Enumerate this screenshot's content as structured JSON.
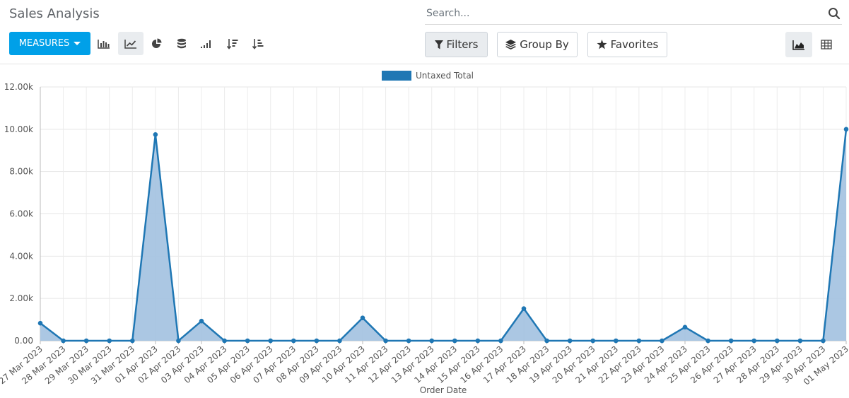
{
  "header": {
    "title": "Sales Analysis"
  },
  "search": {
    "placeholder": "Search...",
    "icon": "search-icon"
  },
  "toolbar": {
    "measures_label": "MEASURES",
    "chart_types": [
      "bar-chart-icon",
      "line-chart-icon",
      "pie-chart-icon",
      "stack-icon",
      "ascending-icon",
      "sort-descending-icon",
      "sort-ascending-icon"
    ],
    "active_chart_type": "line-chart-icon"
  },
  "filters": {
    "filters_label": "Filters",
    "group_by_label": "Group By",
    "favorites_label": "Favorites"
  },
  "views": {
    "active": "graph-view",
    "items": [
      "graph-view",
      "pivot-view"
    ]
  },
  "colors": {
    "accent": "#00a0e8",
    "series": "#1f77b4",
    "fill": "#a7c4e2"
  },
  "chart_data": {
    "type": "area",
    "xlabel": "Order Date",
    "ylabel": "",
    "ylim": [
      0,
      12000
    ],
    "yticks": [
      "0.00",
      "2.00k",
      "4.00k",
      "6.00k",
      "8.00k",
      "10.00k",
      "12.00k"
    ],
    "legend": "top-center",
    "grid": true,
    "categories": [
      "27 Mar 2023",
      "28 Mar 2023",
      "29 Mar 2023",
      "30 Mar 2023",
      "31 Mar 2023",
      "01 Apr 2023",
      "02 Apr 2023",
      "03 Apr 2023",
      "04 Apr 2023",
      "05 Apr 2023",
      "06 Apr 2023",
      "07 Apr 2023",
      "08 Apr 2023",
      "09 Apr 2023",
      "10 Apr 2023",
      "11 Apr 2023",
      "12 Apr 2023",
      "13 Apr 2023",
      "14 Apr 2023",
      "15 Apr 2023",
      "16 Apr 2023",
      "17 Apr 2023",
      "18 Apr 2023",
      "19 Apr 2023",
      "20 Apr 2023",
      "21 Apr 2023",
      "22 Apr 2023",
      "23 Apr 2023",
      "24 Apr 2023",
      "25 Apr 2023",
      "26 Apr 2023",
      "27 Apr 2023",
      "28 Apr 2023",
      "29 Apr 2023",
      "30 Apr 2023",
      "01 May 2023"
    ],
    "series": [
      {
        "name": "Untaxed Total",
        "values": [
          830,
          0,
          0,
          0,
          0,
          9750,
          0,
          930,
          0,
          0,
          0,
          0,
          0,
          0,
          1080,
          0,
          0,
          0,
          0,
          0,
          0,
          1520,
          0,
          0,
          0,
          0,
          0,
          0,
          640,
          0,
          0,
          0,
          0,
          0,
          0,
          10000
        ]
      }
    ]
  }
}
